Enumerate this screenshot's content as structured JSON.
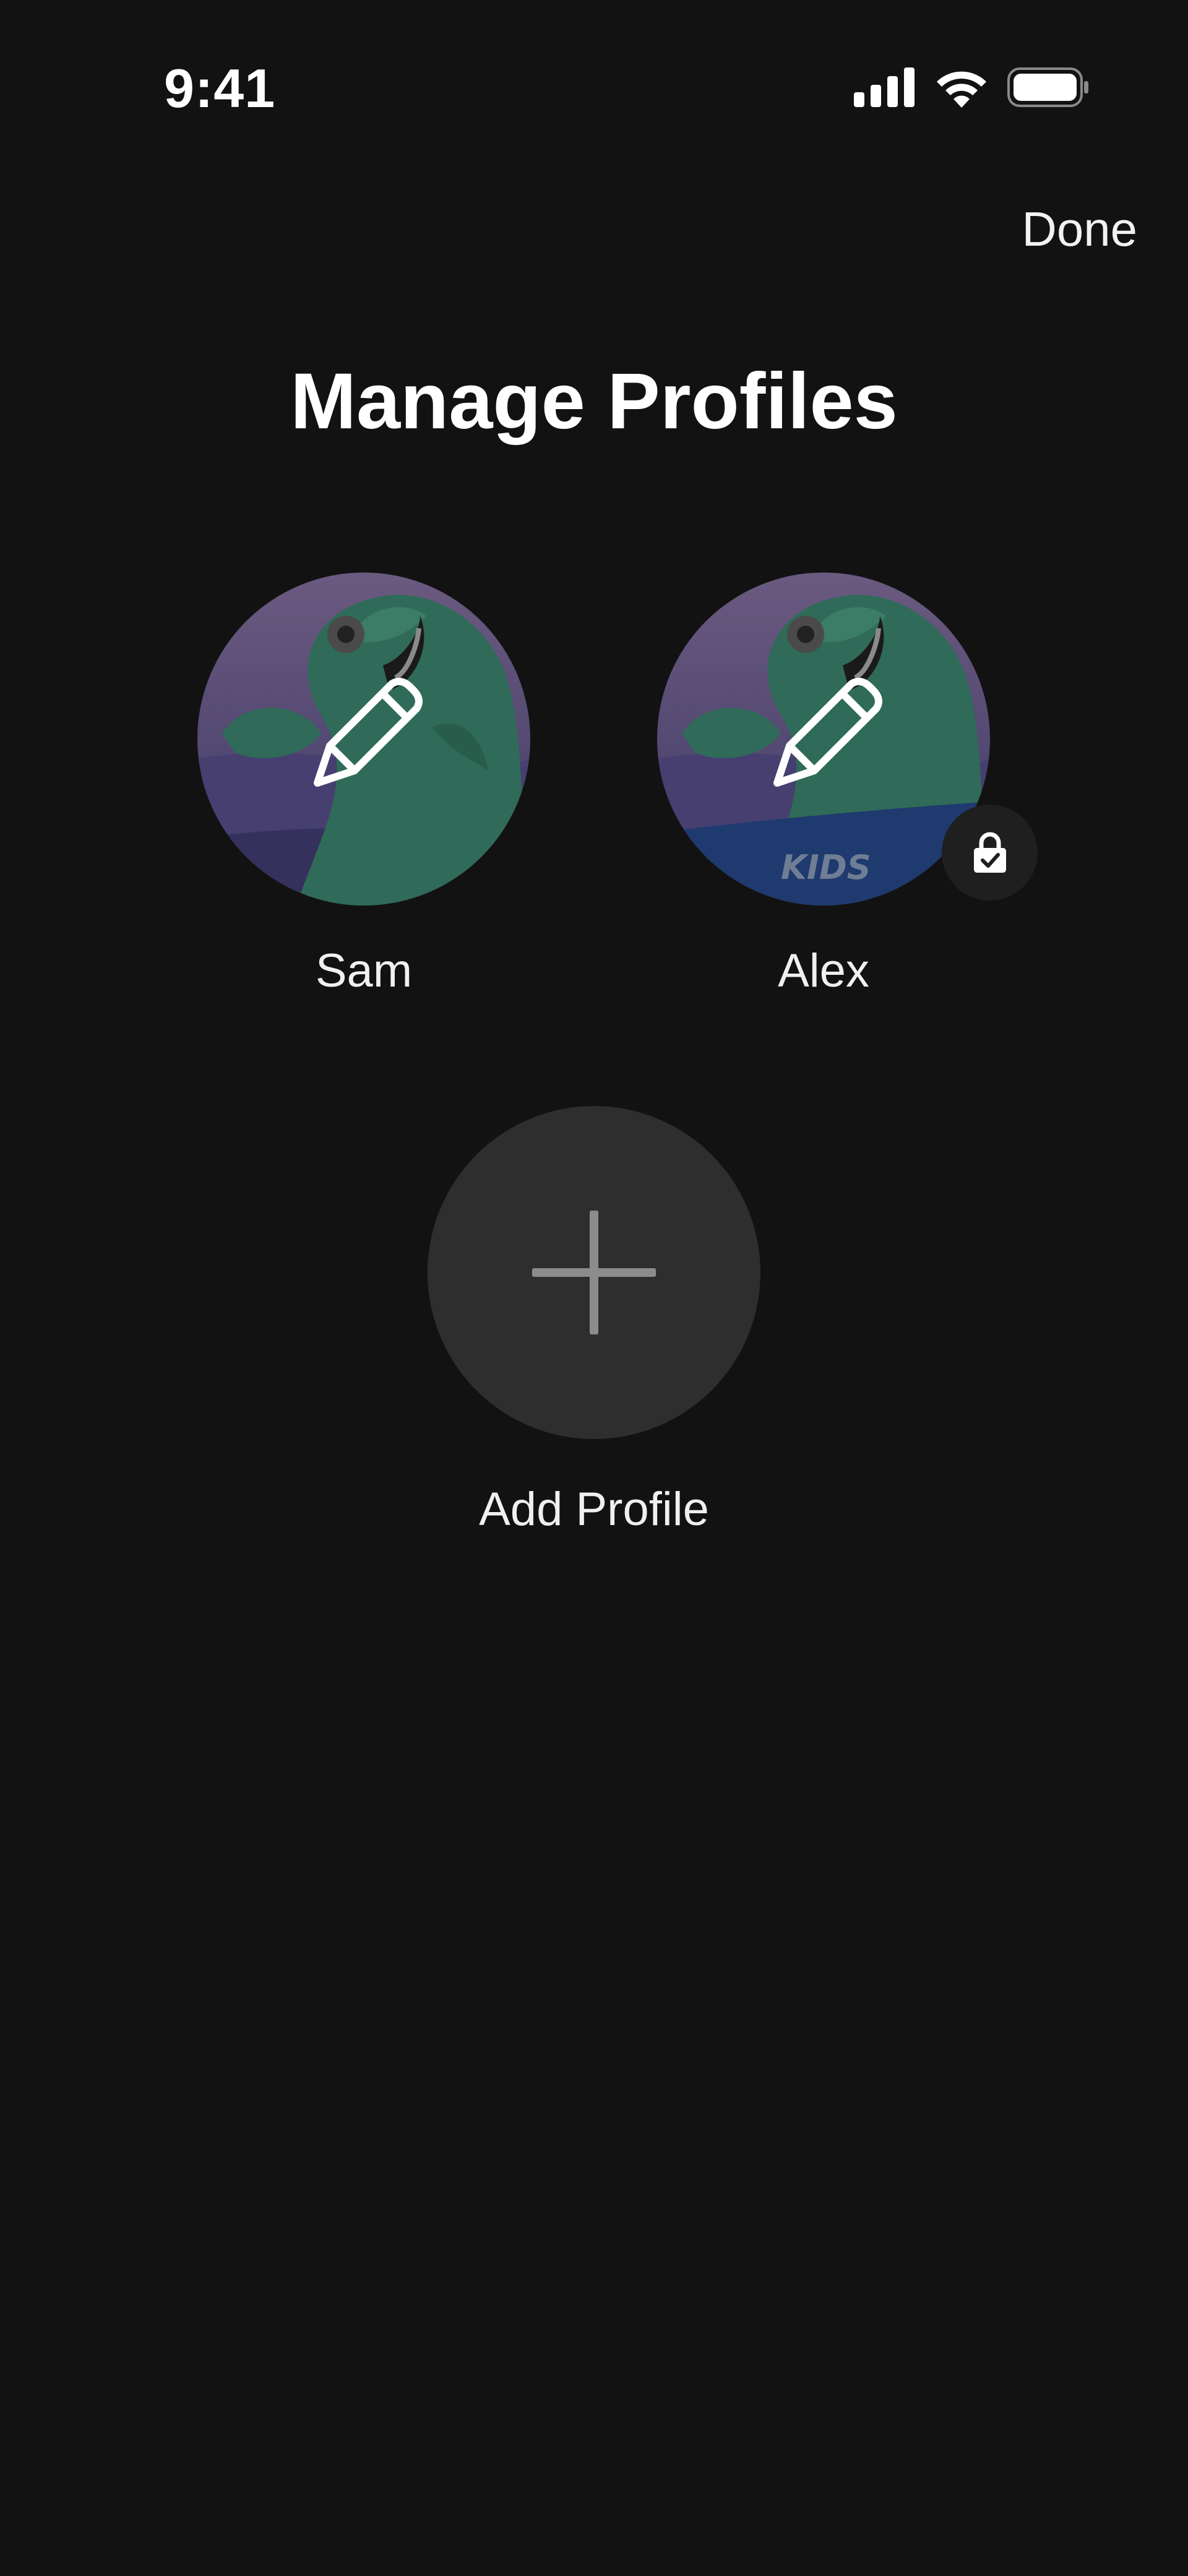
{
  "status_bar": {
    "time": "9:41",
    "icons": [
      "cellular-signal-icon",
      "wifi-icon",
      "battery-icon"
    ]
  },
  "header": {
    "done_label": "Done"
  },
  "page": {
    "title": "Manage Profiles"
  },
  "profiles": [
    {
      "name": "Sam",
      "avatar": "dinosaur-avatar",
      "overlay_icon": "pencil-icon",
      "locked": false
    },
    {
      "name": "Alex",
      "avatar": "dinosaur-avatar-kids",
      "avatar_tag": "KIDS",
      "overlay_icon": "pencil-icon",
      "locked": true,
      "badge_icon": "lock-icon"
    }
  ],
  "add_profile": {
    "label": "Add Profile",
    "icon": "plus-icon"
  },
  "colors": {
    "background": "#121212",
    "add_circle": "#2e2e2e",
    "badge": "#1f1f1f",
    "avatar_green": "#2f6b58",
    "avatar_purple": "#5a4d73",
    "kids_band": "#1e3a6e"
  }
}
